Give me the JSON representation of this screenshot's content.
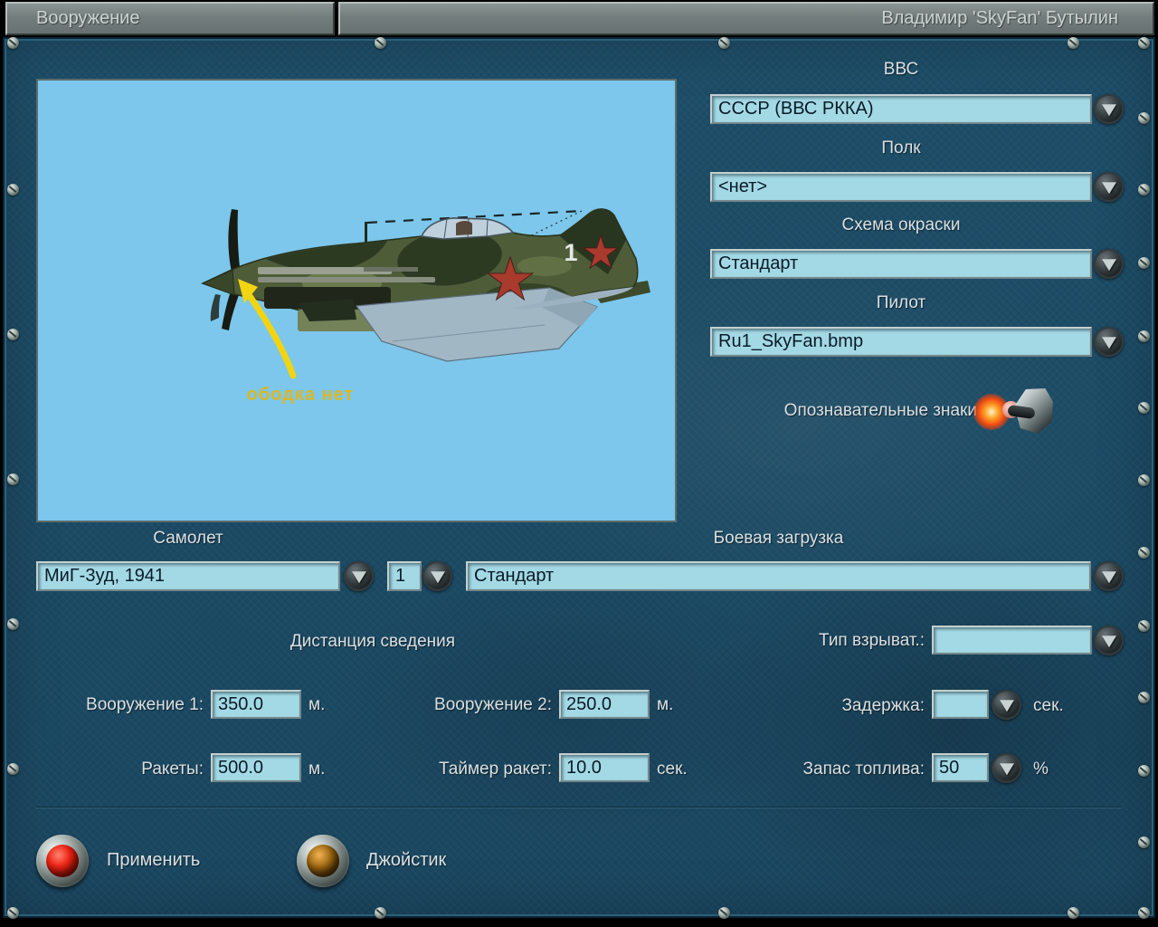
{
  "header": {
    "tab_label": "Вооружение",
    "player_name": "Владимир 'SkyFan' Бутылин"
  },
  "side_panel": {
    "air_force": {
      "label": "ВВС",
      "value": "СССР (ВВС РККА)"
    },
    "regiment": {
      "label": "Полк",
      "value": "<нет>"
    },
    "paint_scheme": {
      "label": "Схема окраски",
      "value": "Стандарт"
    },
    "pilot": {
      "label": "Пилот",
      "value": "Ru1_SkyFan.bmp"
    },
    "markings_label": "Опознавательные знаки"
  },
  "preview": {
    "annotation": "ободка нет",
    "tail_number": "1"
  },
  "aircraft_row": {
    "aircraft_label": "Самолет",
    "aircraft_value": "МиГ-3уд, 1941",
    "number_value": "1",
    "loadout_label": "Боевая загрузка",
    "loadout_value": "Стандарт"
  },
  "weapons": {
    "title": "Дистанция сведения",
    "weapon1": {
      "label": "Вооружение 1:",
      "value": "350.0",
      "unit": "м."
    },
    "weapon2": {
      "label": "Вооружение 2:",
      "value": "250.0",
      "unit": "м."
    },
    "rockets": {
      "label": "Ракеты:",
      "value": "500.0",
      "unit": "м."
    },
    "rocket_timer": {
      "label": "Таймер ракет:",
      "value": "10.0",
      "unit": "сек."
    },
    "fuse_type": {
      "label": "Тип взрыват.:",
      "value": ""
    },
    "delay": {
      "label": "Задержка:",
      "value": "",
      "unit": "сек."
    },
    "fuel": {
      "label": "Запас топлива:",
      "value": "50",
      "unit": "%"
    }
  },
  "footer": {
    "apply_label": "Применить",
    "joystick_label": "Джойстик"
  },
  "colors": {
    "panel_teal": "#1d4c66",
    "field_blue": "#a3d9e4",
    "sky_blue": "#7cc7eb",
    "annotation_yellow": "#dcb723",
    "arrow_yellow": "#f2d413",
    "star_red": "#a83a2e",
    "lamp_red": "#d41a10",
    "lamp_amber": "#8a5207"
  }
}
